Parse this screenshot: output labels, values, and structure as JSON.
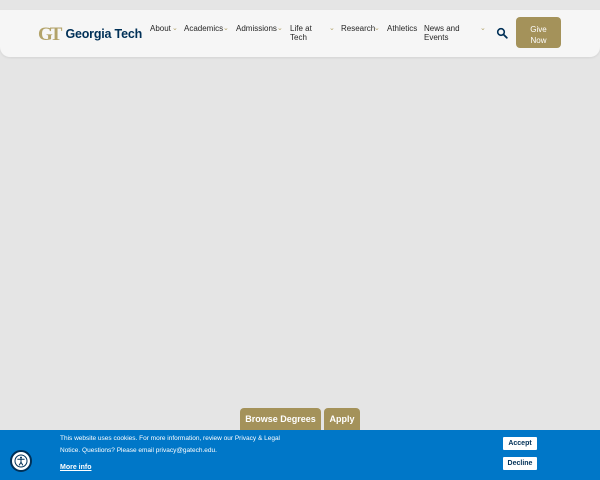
{
  "header": {
    "logo_mark": "GT",
    "logo_text": "Georgia Tech",
    "nav": [
      {
        "label": "About"
      },
      {
        "label": "Academics"
      },
      {
        "label": "Admissions"
      },
      {
        "label": "Life at\nTech"
      },
      {
        "label": "Research"
      },
      {
        "label": "Athletics"
      },
      {
        "label": "News and\nEvents"
      }
    ],
    "give_label": "Give\nNow"
  },
  "cta": {
    "browse_label": "Browse Degrees",
    "apply_label": "Apply"
  },
  "cookie": {
    "text_line1": "This website uses cookies. For more information, review our Privacy & Legal",
    "text_line2": "Notice. Questions? Please email privacy@gatech.edu.",
    "more_info": "More info",
    "accept_label": "Accept",
    "decline_label": "Decline"
  },
  "colors": {
    "gold": "#b3a369",
    "gold_button": "#a4925a",
    "navy": "#003057",
    "cookie_blue": "#0077c8"
  }
}
